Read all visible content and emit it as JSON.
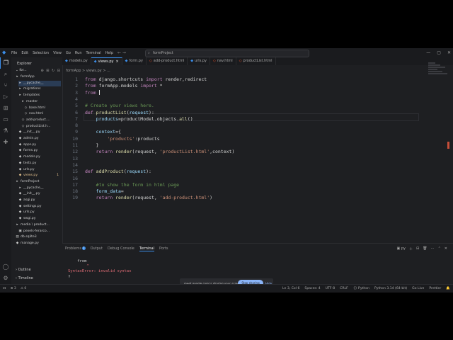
{
  "window": {
    "menu": [
      "File",
      "Edit",
      "Selection",
      "View",
      "Go",
      "Run",
      "Terminal",
      "Help"
    ],
    "search_text": "formProject"
  },
  "sidebar": {
    "header": "Explorer",
    "root": "for...",
    "tree": [
      {
        "label": "formApp",
        "icon": "folder",
        "indent": 1,
        "color": "normal"
      },
      {
        "label": "__pycache__",
        "icon": "folder",
        "indent": 2,
        "color": "normal",
        "selected": true
      },
      {
        "label": "migrations",
        "icon": "folder",
        "indent": 2,
        "color": "normal"
      },
      {
        "label": "templates",
        "icon": "folder",
        "indent": 2,
        "color": "normal"
      },
      {
        "label": "master",
        "icon": "folder",
        "indent": 3,
        "color": "normal"
      },
      {
        "label": "base.html",
        "icon": "html",
        "indent": 4,
        "color": "normal"
      },
      {
        "label": "nav.html",
        "icon": "html",
        "indent": 4,
        "color": "normal"
      },
      {
        "label": "add-product....",
        "icon": "html",
        "indent": 3,
        "color": "normal"
      },
      {
        "label": "productList.h...",
        "icon": "html",
        "indent": 3,
        "color": "normal"
      },
      {
        "label": "__init__.py",
        "icon": "py",
        "indent": 2,
        "color": "normal"
      },
      {
        "label": "admin.py",
        "icon": "py",
        "indent": 2,
        "color": "normal"
      },
      {
        "label": "apps.py",
        "icon": "py",
        "indent": 2,
        "color": "normal"
      },
      {
        "label": "forms.py",
        "icon": "py",
        "indent": 2,
        "color": "normal"
      },
      {
        "label": "models.py",
        "icon": "py",
        "indent": 2,
        "color": "normal"
      },
      {
        "label": "tests.py",
        "icon": "py",
        "indent": 2,
        "color": "normal"
      },
      {
        "label": "urls.py",
        "icon": "py",
        "indent": 2,
        "color": "normal"
      },
      {
        "label": "views.py",
        "icon": "py",
        "indent": 2,
        "color": "yellow",
        "badge": "1"
      },
      {
        "label": "formProject",
        "icon": "folder",
        "indent": 1,
        "color": "normal"
      },
      {
        "label": "__pycache__",
        "icon": "folder",
        "indent": 2,
        "color": "normal"
      },
      {
        "label": "__init__.py",
        "icon": "py",
        "indent": 2,
        "color": "normal"
      },
      {
        "label": "asgi.py",
        "icon": "py",
        "indent": 2,
        "color": "normal"
      },
      {
        "label": "settings.py",
        "icon": "py",
        "indent": 2,
        "color": "normal"
      },
      {
        "label": "urls.py",
        "icon": "py",
        "indent": 2,
        "color": "normal"
      },
      {
        "label": "wsgi.py",
        "icon": "py",
        "indent": 2,
        "color": "normal"
      },
      {
        "label": "media \\ product...",
        "icon": "folder",
        "indent": 1,
        "color": "normal"
      },
      {
        "label": "pexels-ferarco...",
        "icon": "img",
        "indent": 2,
        "color": "normal"
      },
      {
        "label": "db.sqlite3",
        "icon": "db",
        "indent": 1,
        "color": "normal"
      },
      {
        "label": "manage.py",
        "icon": "py",
        "indent": 1,
        "color": "normal"
      }
    ],
    "sections": [
      "Outline",
      "Timeline"
    ]
  },
  "tabs": [
    {
      "label": "models.py",
      "active": false
    },
    {
      "label": "views.py",
      "active": true,
      "close": "×"
    },
    {
      "label": "form.py",
      "active": false
    },
    {
      "label": "add-product.html",
      "active": false
    },
    {
      "label": "urls.py",
      "active": false
    },
    {
      "label": "nav.html",
      "active": false
    },
    {
      "label": "productList.html",
      "active": false
    }
  ],
  "breadcrumb": "formApp > views.py > ...",
  "code_lines": [
    {
      "n": "1",
      "html": "<span class=\"k\">from</span> django.shortcuts <span class=\"k\">import</span> render,redirect"
    },
    {
      "n": "2",
      "html": "<span class=\"k\">from</span> formApp.models <span class=\"k\">import</span> *"
    },
    {
      "n": "3",
      "html": "<span class=\"k\">from</span> <span class=\"caret\"></span>"
    },
    {
      "n": "4",
      "html": ""
    },
    {
      "n": "5",
      "html": "<span class=\"c\"># Create your views here.</span>"
    },
    {
      "n": "6",
      "html": "<span class=\"k\">def</span> <span class=\"f\">productList</span>(<span class=\"v\">request</span>):"
    },
    {
      "n": "7",
      "html": "    <span class=\"v\">products</span>=productModel.objects.<span class=\"f\">all</span>()"
    },
    {
      "n": "8",
      "html": ""
    },
    {
      "n": "9",
      "html": "    <span class=\"v\">context</span>={"
    },
    {
      "n": "10",
      "html": "        <span class=\"s\">'products'</span>:products"
    },
    {
      "n": "11",
      "html": "    }"
    },
    {
      "n": "12",
      "html": "    <span class=\"k\">return</span> <span class=\"f\">render</span>(request, <span class=\"s\">'productList.html'</span>,context)"
    },
    {
      "n": "13",
      "html": ""
    },
    {
      "n": "14",
      "html": ""
    },
    {
      "n": "15",
      "html": "<span class=\"k\">def</span> <span class=\"f\">addProduct</span>(<span class=\"v\">request</span>):"
    },
    {
      "n": "16",
      "html": ""
    },
    {
      "n": "17",
      "html": "    <span class=\"c\">#to show the form in html page</span>"
    },
    {
      "n": "18",
      "html": "    <span class=\"v\">form_data</span>="
    },
    {
      "n": "19",
      "html": "    <span class=\"k\">return</span> <span class=\"f\">render</span>(request, <span class=\"s\">'add-product.html'</span>)"
    }
  ],
  "panel": {
    "tabs": [
      "Problems",
      "Output",
      "Debug Console",
      "Terminal",
      "Ports"
    ],
    "problems_count": "1",
    "active_tab": "Terminal",
    "shell": "py",
    "terminal_lines": [
      {
        "text": "    from",
        "type": "normal"
      },
      {
        "text": "        ^",
        "type": "err"
      },
      {
        "text": "SyntaxError: invalid syntax",
        "type": "err"
      },
      {
        "text": "▯",
        "type": "normal"
      }
    ]
  },
  "share_bar": {
    "text": "meet.google.com is sharing your screen.",
    "stop_label": "Stop sharing",
    "hide_label": "Hide"
  },
  "statusbar": {
    "errors": "⊗ 3",
    "warnings": "⚠ 0",
    "position": "Ln 3, Col 6",
    "spaces": "Spaces: 4",
    "encoding": "UTF-8",
    "eol": "CRLF",
    "language": "{} Python",
    "interpreter": "Python 3.14 (64-bit)",
    "golive": "Go Live",
    "prettier": "Prettier"
  }
}
